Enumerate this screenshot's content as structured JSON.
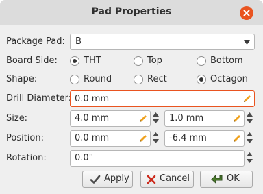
{
  "window": {
    "title": "Pad Properties"
  },
  "labels": {
    "package_pad": "Package Pad:",
    "board_side": "Board Side:",
    "shape": "Shape:",
    "drill_diameter": "Drill Diameter:",
    "size": "Size:",
    "position": "Position:",
    "rotation": "Rotation:"
  },
  "package_pad": {
    "selected": "B"
  },
  "board_side": {
    "options": [
      "THT",
      "Top",
      "Bottom"
    ],
    "selected": "THT"
  },
  "shape": {
    "options": [
      "Round",
      "Rect",
      "Octagon"
    ],
    "selected": "Octagon"
  },
  "drill_diameter": {
    "value": "0.0 mm"
  },
  "size": {
    "width": "4.0 mm",
    "height": "1.0 mm"
  },
  "position": {
    "x": "0.0 mm",
    "y": "-6.4 mm"
  },
  "rotation": {
    "value": "0.0°"
  },
  "buttons": {
    "apply": {
      "first": "A",
      "rest": "pply"
    },
    "cancel": {
      "first": "C",
      "rest": "ancel"
    },
    "ok": {
      "first": "O",
      "rest": "K"
    }
  },
  "colors": {
    "accent": "#e95420",
    "pencil": "#f0a21e"
  },
  "icons": [
    "close-icon",
    "chevron-down-icon",
    "pencil-icon",
    "spin-up-icon",
    "spin-down-icon",
    "check-icon",
    "cancel-x-icon",
    "ok-arrow-icon"
  ]
}
